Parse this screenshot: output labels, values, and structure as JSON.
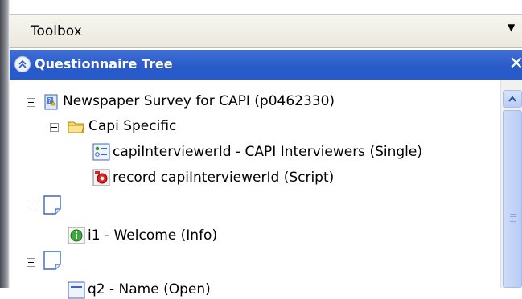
{
  "toolbox": {
    "title": "Toolbox"
  },
  "questionnaire_tree": {
    "title": "Questionnaire Tree",
    "items": [
      {
        "label": "Newspaper Survey for CAPI (p0462330)",
        "icon": "survey-icon"
      },
      {
        "label": "Capi Specific",
        "icon": "folder-icon"
      },
      {
        "label": "capiInterviewerId - CAPI Interviewers (Single)",
        "icon": "single-choice-icon"
      },
      {
        "label": "record capiInterviewerId (Script)",
        "icon": "script-icon"
      },
      {
        "label": "",
        "icon": "page-icon"
      },
      {
        "label": "i1 - Welcome (Info)",
        "icon": "info-icon"
      },
      {
        "label": "",
        "icon": "page-icon"
      },
      {
        "label": "q2 - Name (Open)",
        "icon": "open-question-icon"
      }
    ]
  },
  "colors": {
    "header_blue": "#2a5ac6",
    "toolbar": "#ebe9de"
  }
}
